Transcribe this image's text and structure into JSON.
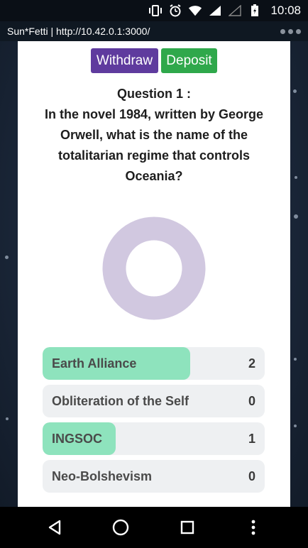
{
  "status_bar": {
    "time": "10:08",
    "icons": [
      "vibrate-icon",
      "alarm-icon",
      "wifi-icon",
      "signal-icon",
      "signal-empty-icon",
      "battery-icon"
    ]
  },
  "browser": {
    "title": "Sun*Fetti | http://10.42.0.1:3000/"
  },
  "actions": {
    "withdraw_label": "Withdraw",
    "deposit_label": "Deposit"
  },
  "question": {
    "heading": "Question 1 :",
    "text": "In the novel 1984, written by George Orwell, what is the name of the totalitarian regime that controls Oceania?"
  },
  "donut": {
    "color": "#d1c8e0"
  },
  "answers": [
    {
      "label": "Earth Alliance",
      "count": "2",
      "fraction": 0.665
    },
    {
      "label": "Obliteration of the Self",
      "count": "0",
      "fraction": 0
    },
    {
      "label": "INGSOC",
      "count": "1",
      "fraction": 0.33
    },
    {
      "label": "Neo-Bolshevism",
      "count": "0",
      "fraction": 0
    }
  ],
  "colors": {
    "withdraw": "#5f3b9e",
    "deposit": "#2fa84b",
    "answer_fill": "#8ee3bd",
    "answer_bg": "#eef0f2"
  },
  "nav": {
    "icons": [
      "back-icon",
      "home-icon",
      "recents-icon",
      "more-icon"
    ]
  }
}
